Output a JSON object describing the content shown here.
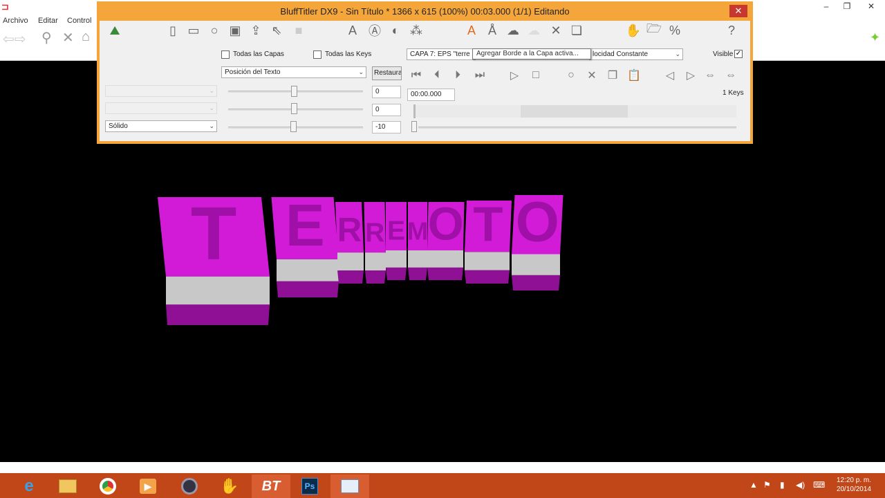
{
  "main_window": {
    "menu": [
      "Archivo",
      "Editar",
      "Control"
    ],
    "min_label": "–",
    "max_label": "❐",
    "close_label": "✕"
  },
  "dialog": {
    "title": "BluffTitler DX9 - Sin Título * 1366 x 615 (100%) 00:03.000 (1/1) Editando",
    "close_label": "✕",
    "chk_all_layers": "Todas las Capas",
    "chk_all_keys": "Todas las Keys",
    "layer_combo": "CAPA   7: EPS \"terre",
    "speed_combo": "locidad Constante",
    "visible_label": "Visible",
    "property_combo": "Posición del Texto",
    "restore_button": "Restaurar",
    "values": [
      "0",
      "0",
      "-10"
    ],
    "style_combo": "Sólido",
    "time_value": "00:00.000",
    "keys_label": "1 Keys",
    "tooltip": "Agregar Borde a la Capa activa..."
  },
  "canvas": {
    "title_text": "TERREMOTO",
    "colors": {
      "face": "#d21bd6",
      "side": "#c8c8c8",
      "shadow": "#8f0f95"
    }
  },
  "taskbar": {
    "clock_time": "12:20 p. m.",
    "clock_date": "20/10/2014",
    "tray_icons": [
      "up-arrow-icon",
      "flag-icon",
      "network-icon",
      "volume-icon",
      "keyboard-icon"
    ]
  }
}
